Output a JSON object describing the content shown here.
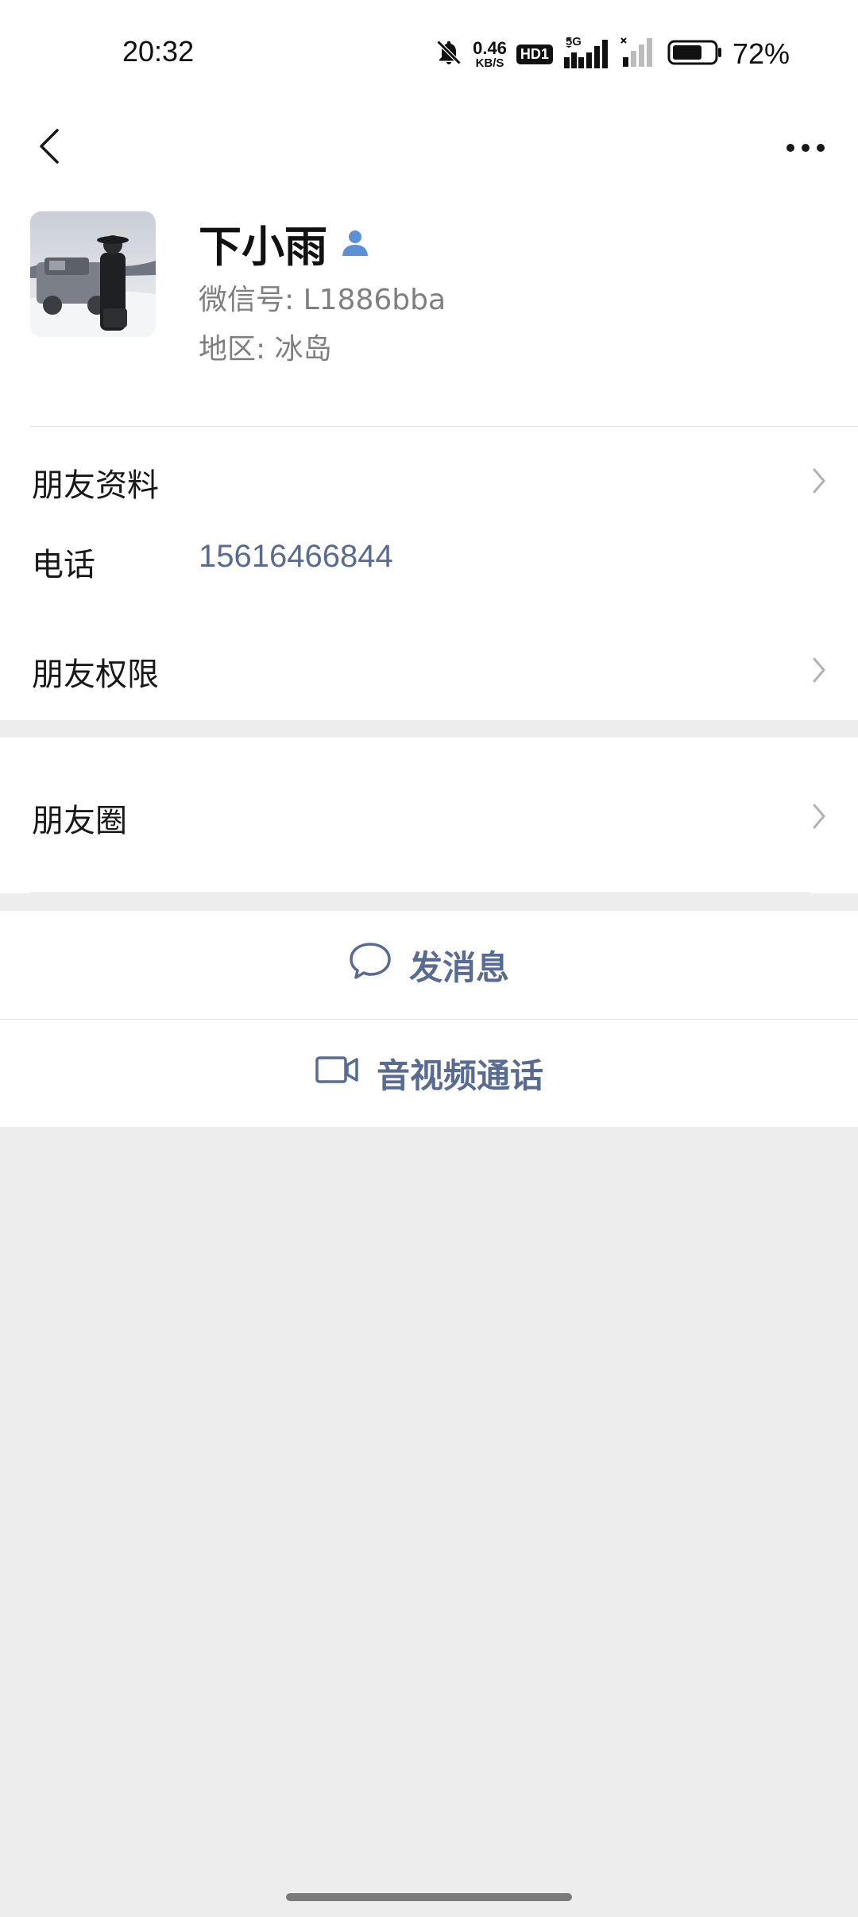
{
  "status_bar": {
    "time": "20:32",
    "net_speed_value": "0.46",
    "net_speed_unit": "KB/S",
    "hd_label": "HD1",
    "network_label": "5G",
    "battery_percent": "72%",
    "battery_level": 0.72,
    "icons": [
      "bell-off-icon",
      "signal-icon",
      "signal-weak-icon",
      "battery-icon"
    ]
  },
  "nav": {
    "back_icon": "chevron-left-icon",
    "more_icon": "more-horizontal-icon"
  },
  "profile": {
    "name": "下小雨",
    "name_icon": "contact-person-icon",
    "wechat_id": "微信号: L1886bba",
    "region": "地区: 冰岛"
  },
  "rows": {
    "friend_profile": "朋友资料",
    "phone_label": "电话",
    "phone_value": "15616466844",
    "friend_permissions": "朋友权限",
    "moments": "朋友圈"
  },
  "actions": {
    "message_label": "发消息",
    "message_icon": "chat-bubble-icon",
    "call_label": "音视频通话",
    "call_icon": "video-camera-icon"
  },
  "colors": {
    "link_blue": "#576b95",
    "background": "#ededed",
    "icon_blue": "#5b8fd6"
  }
}
